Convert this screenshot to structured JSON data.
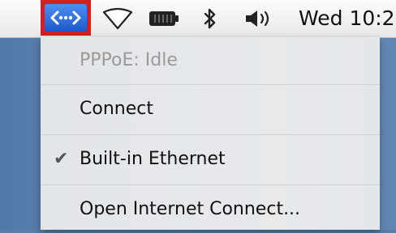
{
  "menubar": {
    "clock": "Wed 10:2",
    "icons": [
      "network-icon",
      "wifi-icon",
      "battery-icon",
      "bluetooth-icon",
      "volume-icon"
    ]
  },
  "menu": {
    "items": [
      {
        "label": "PPPoE: Idle",
        "enabled": false,
        "checked": false
      },
      {
        "label": "Connect",
        "enabled": true,
        "checked": false
      },
      {
        "label": "Built-in Ethernet",
        "enabled": true,
        "checked": true
      },
      {
        "label": "Open Internet Connect...",
        "enabled": true,
        "checked": false
      }
    ]
  },
  "colors": {
    "highlight_box": "#cc2222",
    "network_icon": "#2a64d6"
  }
}
